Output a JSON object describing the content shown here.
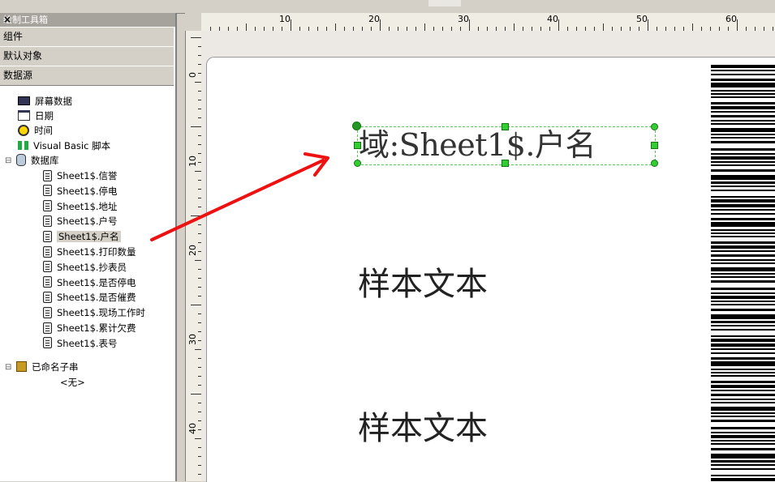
{
  "panel": {
    "title": "绘制工具箱",
    "close": "×",
    "sections": [
      "组件",
      "默认对象",
      "数据源"
    ]
  },
  "tree": {
    "items": [
      {
        "label": "屏幕数据",
        "icon": "monitor-icon"
      },
      {
        "label": "日期",
        "icon": "calendar-icon"
      },
      {
        "label": "时间",
        "icon": "clock-icon"
      },
      {
        "label": "Visual Basic 脚本",
        "icon": "script-icon"
      },
      {
        "label": "数据库",
        "icon": "database-icon"
      }
    ],
    "fields": [
      "Sheet1$.信誉",
      "Sheet1$.停电",
      "Sheet1$.地址",
      "Sheet1$.户号",
      "Sheet1$.户名",
      "Sheet1$.打印数量",
      "Sheet1$.抄表员",
      "Sheet1$.是否停电",
      "Sheet1$.是否催费",
      "Sheet1$.现场工作时",
      "Sheet1$.累计欠费",
      "Sheet1$.表号"
    ],
    "named": "已命名子串",
    "none": "<无>"
  },
  "ruler": {
    "h": [
      "10",
      "20",
      "30",
      "40",
      "50",
      "60"
    ],
    "v": [
      "0",
      "10",
      "20",
      "30",
      "40"
    ]
  },
  "canvas": {
    "field_text": "域:Sheet1$.户名",
    "sample1": "样本文本",
    "sample2": "样本文本"
  },
  "colors": {
    "arrow": "#ee1111",
    "selection": "#33cc33"
  }
}
